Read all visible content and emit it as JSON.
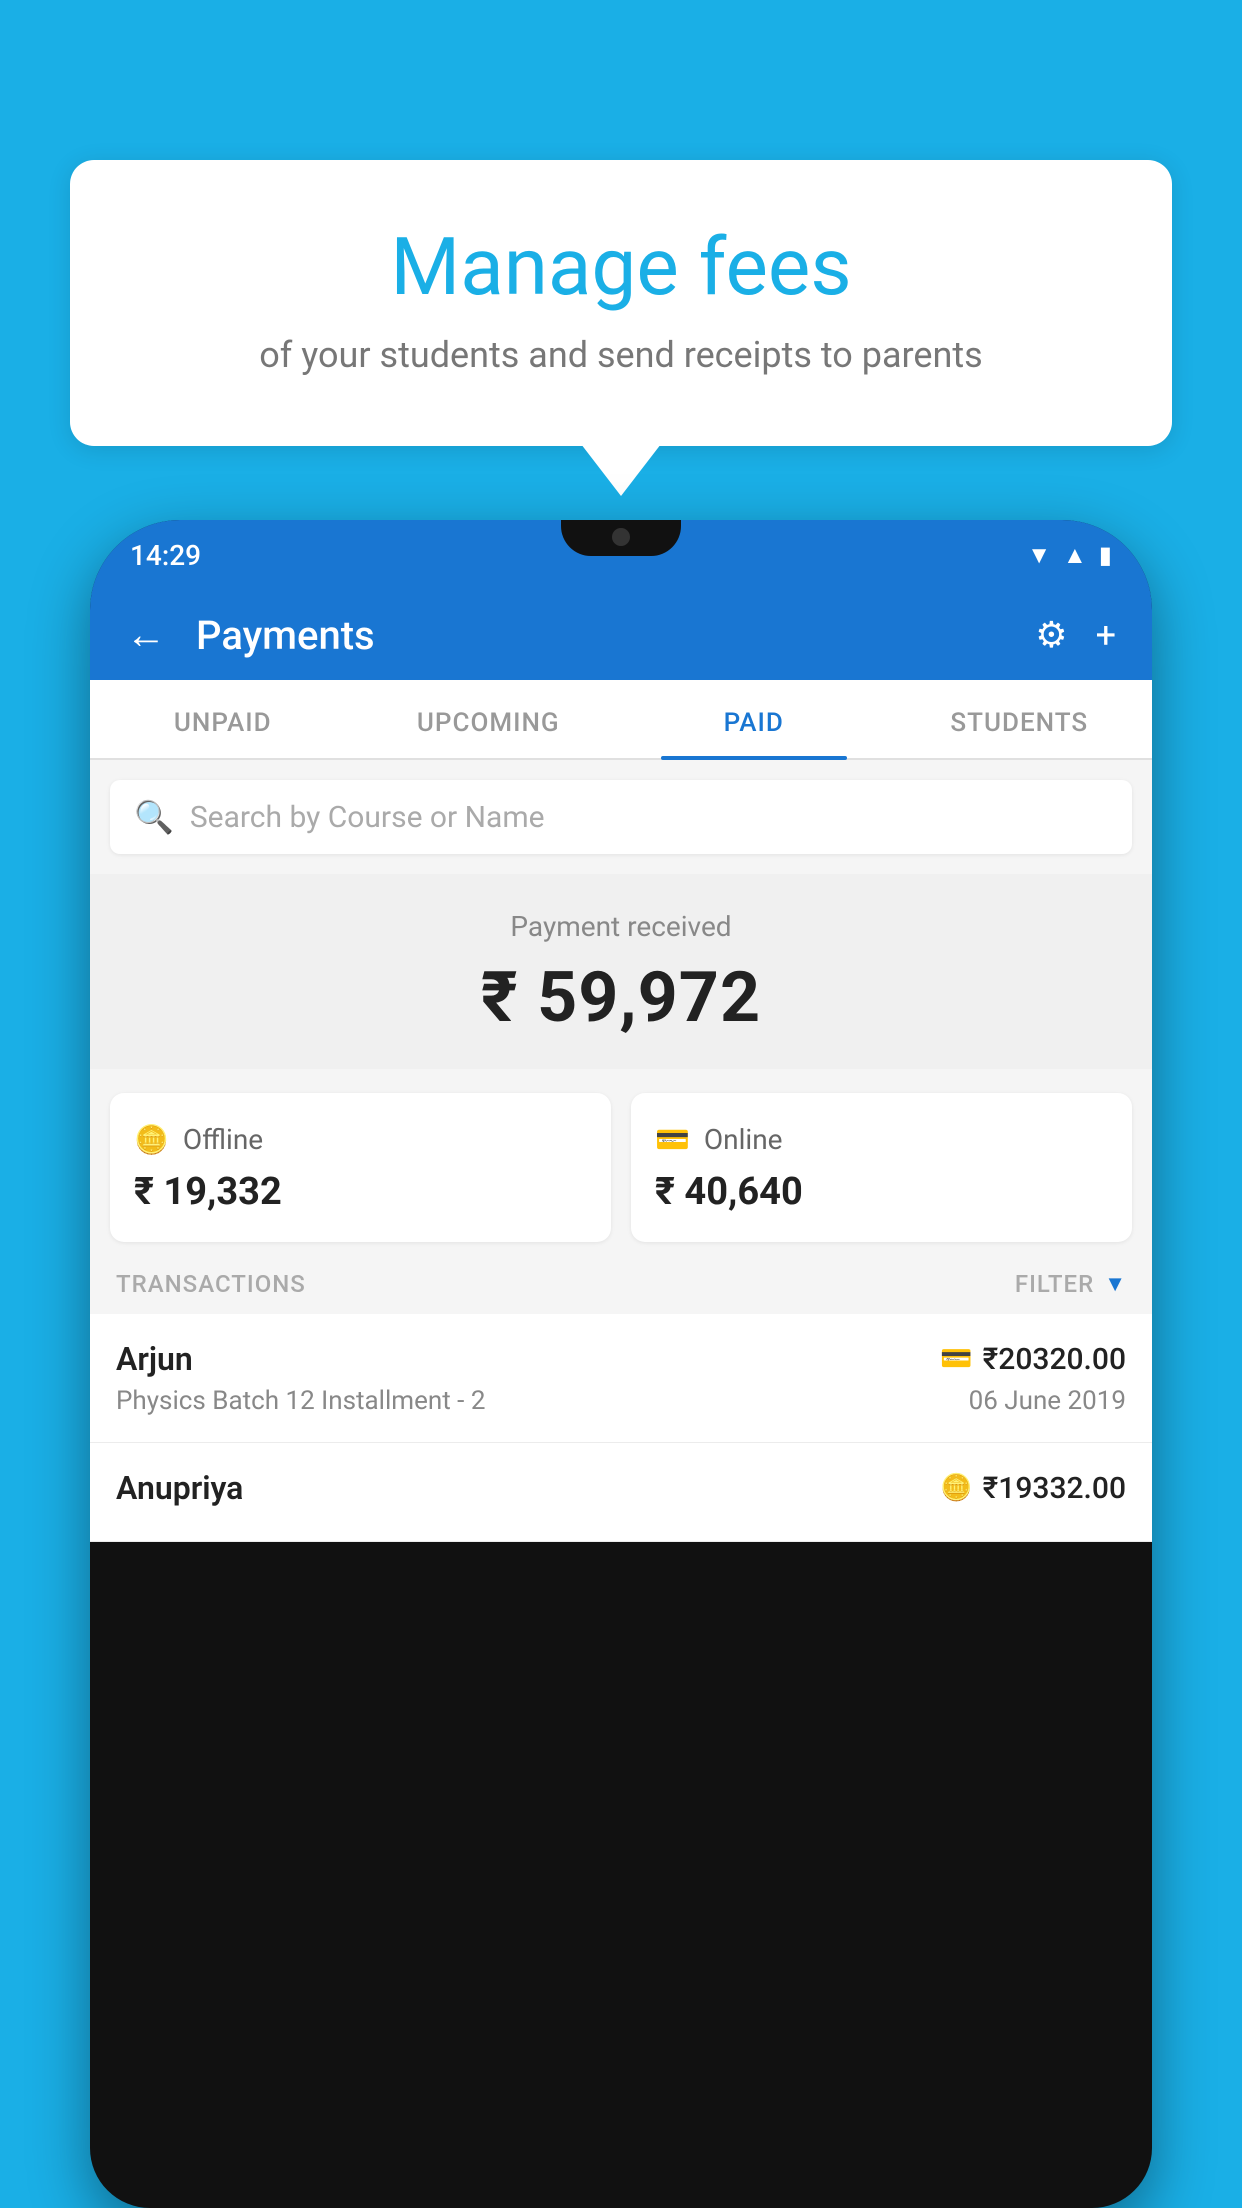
{
  "background_color": "#1AAFE6",
  "speech_bubble": {
    "title": "Manage fees",
    "subtitle": "of your students and send receipts to parents"
  },
  "phone": {
    "status_bar": {
      "time": "14:29",
      "icons": [
        "wifi",
        "signal",
        "battery"
      ]
    },
    "header": {
      "title": "Payments",
      "back_label": "←",
      "settings_icon": "gear",
      "add_icon": "+"
    },
    "tabs": [
      {
        "label": "UNPAID",
        "active": false
      },
      {
        "label": "UPCOMING",
        "active": false
      },
      {
        "label": "PAID",
        "active": true
      },
      {
        "label": "STUDENTS",
        "active": false
      }
    ],
    "search": {
      "placeholder": "Search by Course or Name"
    },
    "payment_received": {
      "label": "Payment received",
      "amount": "₹ 59,972"
    },
    "payment_cards": [
      {
        "type": "Offline",
        "icon": "cash",
        "amount": "₹ 19,332"
      },
      {
        "type": "Online",
        "icon": "card",
        "amount": "₹ 40,640"
      }
    ],
    "transactions": {
      "label": "TRANSACTIONS",
      "filter_label": "FILTER",
      "rows": [
        {
          "name": "Arjun",
          "detail": "Physics Batch 12 Installment - 2",
          "amount": "₹20320.00",
          "date": "06 June 2019",
          "icon": "card"
        },
        {
          "name": "Anupriya",
          "detail": "",
          "amount": "₹19332.00",
          "date": "",
          "icon": "cash"
        }
      ]
    }
  }
}
